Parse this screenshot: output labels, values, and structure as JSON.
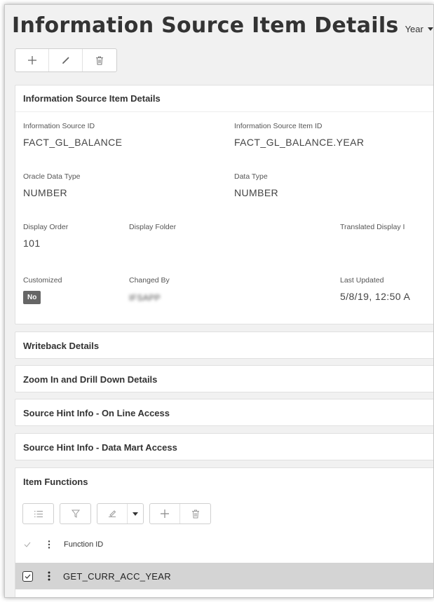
{
  "header": {
    "title": "Information Source Item Details",
    "context_selector": "Year"
  },
  "commands": {
    "new_icon": "plus-icon",
    "edit_icon": "pencil-icon",
    "delete_icon": "trash-icon"
  },
  "details": {
    "heading": "Information Source Item Details",
    "fields": {
      "info_source_id": {
        "label": "Information Source ID",
        "value": "FACT_GL_BALANCE"
      },
      "info_source_item_id": {
        "label": "Information Source Item ID",
        "value": "FACT_GL_BALANCE.YEAR"
      },
      "oracle_data_type": {
        "label": "Oracle Data Type",
        "value": "NUMBER"
      },
      "data_type": {
        "label": "Data Type",
        "value": "NUMBER"
      },
      "display_order": {
        "label": "Display Order",
        "value": "101"
      },
      "display_folder": {
        "label": "Display Folder",
        "value": ""
      },
      "translated_display": {
        "label": "Translated Display I",
        "value": ""
      },
      "customized": {
        "label": "Customized",
        "value": "No"
      },
      "changed_by": {
        "label": "Changed By",
        "value": "IFSAPP"
      },
      "last_updated": {
        "label": "Last Updated",
        "value": "5/8/19, 12:50 A"
      }
    }
  },
  "sections": {
    "writeback": "Writeback Details",
    "zoom": "Zoom In and Drill Down Details",
    "online_access": "Source Hint Info - On Line Access",
    "data_mart_access": "Source Hint Info - Data Mart Access"
  },
  "item_functions": {
    "heading": "Item Functions",
    "toolbar_icons": [
      "list-icon",
      "filter-icon",
      "bulk-edit-icon",
      "chevron-down-icon",
      "plus-icon",
      "trash-icon"
    ],
    "columns": {
      "function_id": "Function ID"
    },
    "rows": [
      {
        "function_id": "GET_CURR_ACC_YEAR"
      }
    ]
  }
}
